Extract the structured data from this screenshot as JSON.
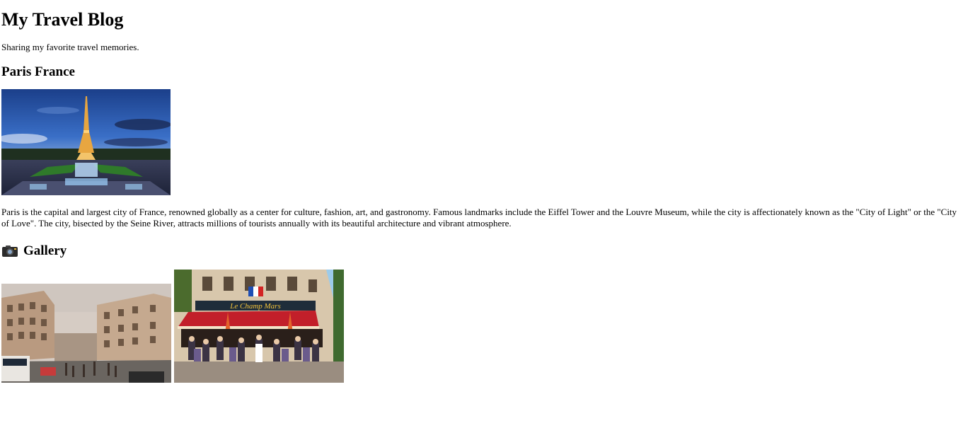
{
  "header": {
    "title": "My Travel Blog",
    "tagline": "Sharing my favorite travel memories."
  },
  "post": {
    "title": "Paris France",
    "hero_alt": "Eiffel Tower at dusk",
    "description": "Paris is the capital and largest city of France, renowned globally as a center for culture, fashion, art, and gastronomy. Famous landmarks include the Eiffel Tower and the Louvre Museum, while the city is affectionately known as the \"City of Light\" or the \"City of Love\". The city, bisected by the Seine River, attracts millions of tourists annually with its beautiful architecture and vibrant atmosphere."
  },
  "gallery": {
    "icon": "camera-icon",
    "title": "Gallery",
    "images": [
      {
        "alt": "Busy Paris boulevard"
      },
      {
        "alt": "Le Champ de Mars cafe terrace"
      }
    ],
    "cafe_sign": "Le Champ Mars"
  }
}
